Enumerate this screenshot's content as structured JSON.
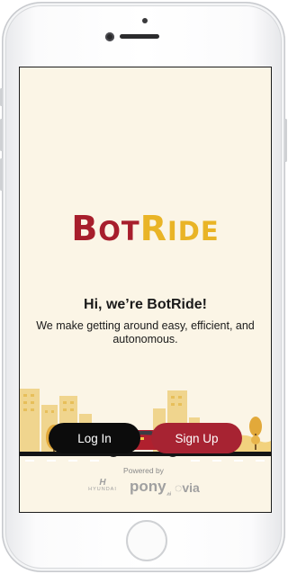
{
  "app": {
    "logo": {
      "part1_b": "B",
      "part1_rest": "OT",
      "part2_r": "R",
      "part2_rest": "IDE"
    },
    "headline": "Hi, we’re BotRide!",
    "subline": "We make getting around easy, efficient, and autonomous.",
    "buttons": {
      "login": "Log In",
      "signup": "Sign Up"
    },
    "powered_by": "Powered by",
    "partners": {
      "hyundai_mark": "H",
      "hyundai_text": "HYUNDAI",
      "pony": "pony",
      "pony_suffix": ".ai",
      "via": "via"
    }
  },
  "colors": {
    "brand_red": "#a71e2c",
    "brand_yellow": "#e9b426",
    "screen_bg": "#fbf5e6",
    "login_bg": "#0c0c0c",
    "signup_bg": "#a72332"
  }
}
